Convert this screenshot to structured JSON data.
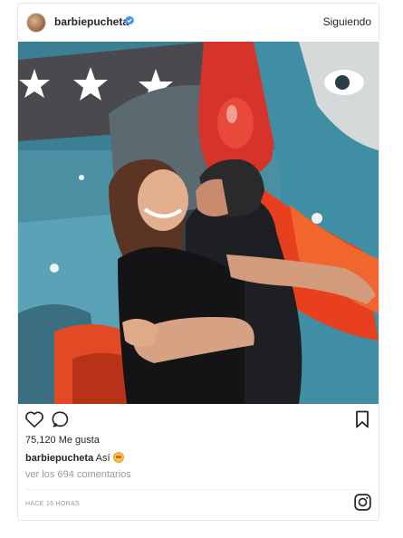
{
  "post": {
    "username": "barbiepucheta",
    "follow_label": "Siguiendo",
    "likes_text": "75,120 Me gusta",
    "caption_user": "barbiepucheta",
    "caption_text": "Así",
    "caption_emoji": "heart-eyes-emoji",
    "comments_link": "ver los 694 comentarios",
    "timestamp": "HACE 16 HORAS"
  },
  "icons": {
    "verified": "verified-badge-icon",
    "like": "heart-icon",
    "comment": "comment-icon",
    "save": "bookmark-icon",
    "brand": "instagram-icon"
  },
  "colors": {
    "text": "#262626",
    "muted": "#999999",
    "verified_blue": "#3897f0",
    "border": "#e6e6e6"
  }
}
